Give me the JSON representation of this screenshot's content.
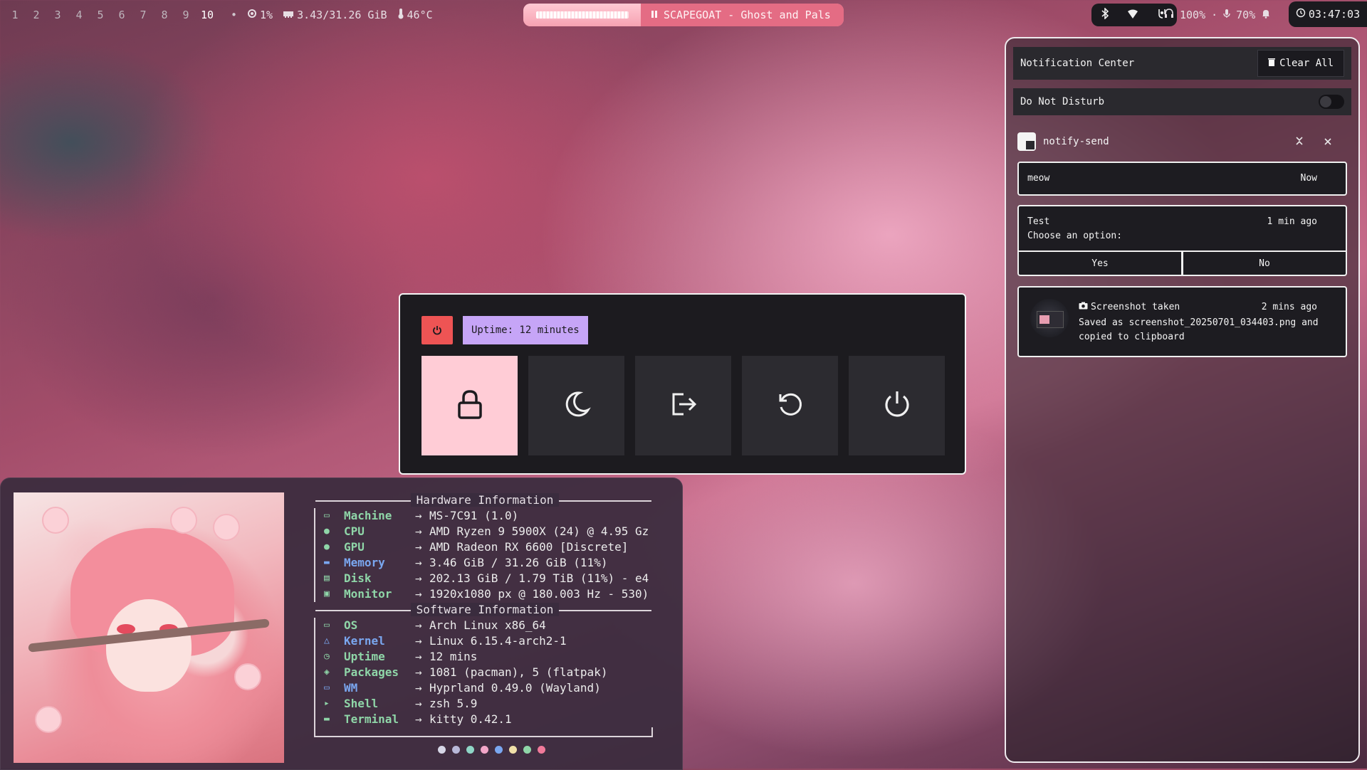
{
  "topbar": {
    "workspaces": [
      "1",
      "2",
      "3",
      "4",
      "5",
      "6",
      "7",
      "8",
      "9",
      "10"
    ],
    "active_workspace": "10",
    "separator": "•",
    "cpu": "1%",
    "memory": "3.43/31.26 GiB",
    "temperature": "46°C",
    "media": {
      "icon": "pause-icon",
      "text": "SCAPEGOAT - Ghost and Pals"
    },
    "battery": "100%",
    "mic": "70%",
    "mid_dot": "·",
    "clock": "03:47:03"
  },
  "power_menu": {
    "uptime": "Uptime: 12 minutes",
    "buttons": [
      "lock",
      "suspend",
      "logout",
      "reboot",
      "shutdown"
    ],
    "selected": "lock",
    "colors": {
      "power": "#ee5454",
      "uptime": "#c6a5f7",
      "selected": "#ffccd6"
    }
  },
  "fastfetch": {
    "hardware_title": "Hardware Information",
    "software_title": "Software Information",
    "hardware": [
      {
        "icon": "laptop-icon",
        "key": "Machine",
        "value": "MS-7C91 (1.0)"
      },
      {
        "icon": "cpu-icon",
        "key": "CPU",
        "value": "AMD Ryzen 9 5900X (24) @ 4.95 Gz"
      },
      {
        "icon": "gpu-icon",
        "key": "GPU",
        "value": "AMD Radeon RX 6600 [Discrete]"
      },
      {
        "icon": "memory-icon",
        "key": "Memory",
        "value": "3.46 GiB / 31.26 GiB (11%)"
      },
      {
        "icon": "disk-icon",
        "key": "Disk",
        "value": "202.13 GiB / 1.79 TiB (11%) - e4"
      },
      {
        "icon": "monitor-icon",
        "key": "Monitor",
        "value": "1920x1080 px @ 180.003 Hz - 530)"
      }
    ],
    "software": [
      {
        "icon": "os-icon",
        "key": "OS",
        "value": "Arch Linux x86_64"
      },
      {
        "icon": "kernel-icon",
        "key": "Kernel",
        "value": "Linux 6.15.4-arch2-1"
      },
      {
        "icon": "clock-icon",
        "key": "Uptime",
        "value": "12 mins"
      },
      {
        "icon": "package-icon",
        "key": "Packages",
        "value": "1081 (pacman), 5 (flatpak)"
      },
      {
        "icon": "window-icon",
        "key": "WM",
        "value": "Hyprland 0.49.0 (Wayland)"
      },
      {
        "icon": "shell-icon",
        "key": "Shell",
        "value": "zsh 5.9"
      },
      {
        "icon": "terminal-icon",
        "key": "Terminal",
        "value": "kitty 0.42.1"
      }
    ],
    "palette": [
      "#d6d6e6",
      "#b8b8d8",
      "#8fd6c6",
      "#f2a6c8",
      "#7aa7f0",
      "#f0e0a8",
      "#8fd6a8",
      "#f07a9a"
    ]
  },
  "notifications": {
    "title": "Notification Center",
    "clear_all": "Clear All",
    "dnd_label": "Do Not Disturb",
    "app_name": "notify-send",
    "items": [
      {
        "body": "meow",
        "time": "Now"
      },
      {
        "title": "Test",
        "body": "Choose an option:",
        "time": "1 min ago",
        "actions": [
          "Yes",
          "No"
        ]
      },
      {
        "title": "Screenshot taken",
        "body": "Saved as screenshot_20250701_034403.png and copied to clipboard",
        "time": "2 mins ago"
      }
    ]
  }
}
